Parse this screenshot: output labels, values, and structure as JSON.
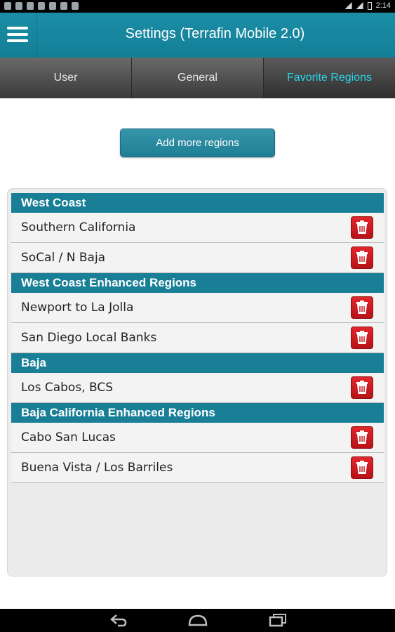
{
  "status_bar": {
    "time": "2:14"
  },
  "app_bar": {
    "title": "Settings (Terrafin Mobile 2.0)",
    "menu_icon": "hamburger-menu-icon"
  },
  "tabs": [
    {
      "label": "User",
      "active": false
    },
    {
      "label": "General",
      "active": false
    },
    {
      "label": "Favorite Regions",
      "active": true
    }
  ],
  "add_button": {
    "label": "Add more regions"
  },
  "colors": {
    "accent": "#197f97",
    "active_tab_text": "#2ad4e8",
    "delete_red": "#c8161c"
  },
  "regions": {
    "sections": [
      {
        "title": "West Coast",
        "items": [
          "Southern California",
          "SoCal / N Baja"
        ]
      },
      {
        "title": "West Coast Enhanced Regions",
        "items": [
          "Newport to La Jolla",
          "San Diego Local Banks"
        ]
      },
      {
        "title": "Baja",
        "items": [
          "Los Cabos, BCS"
        ]
      },
      {
        "title": "Baja California Enhanced Regions",
        "items": [
          "Cabo San Lucas",
          "Buena Vista / Los Barriles"
        ]
      }
    ]
  },
  "nav_bar": {
    "icons": [
      "back-icon",
      "home-icon",
      "recent-apps-icon"
    ]
  }
}
